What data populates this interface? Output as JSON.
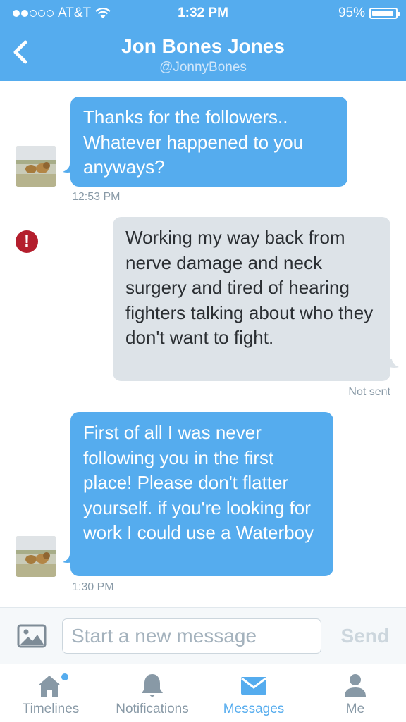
{
  "status_bar": {
    "carrier": "AT&T",
    "time": "1:32 PM",
    "battery": "95%",
    "battery_level": 0.95
  },
  "header": {
    "title": "Jon Bones Jones",
    "handle": "@JonnyBones"
  },
  "messages": [
    {
      "direction": "incoming",
      "text": "Thanks for the followers.. Whatever happened to you anyways?",
      "time": "12:53 PM"
    },
    {
      "direction": "outgoing",
      "text": "Working my way back from nerve damage and neck surgery and tired of hearing fighters talking about who they don't want to fight.",
      "status": "Not sent",
      "error_icon": "exclamation-icon"
    },
    {
      "direction": "incoming",
      "text": "First of all I was never following you in the first place! Please don't flatter yourself. if you're looking for work I could use a Waterboy",
      "time": "1:30 PM"
    }
  ],
  "composer": {
    "placeholder": "Start a new message",
    "send_label": "Send"
  },
  "tabs": [
    {
      "label": "Timelines",
      "icon": "home-icon",
      "active": false,
      "badge": true
    },
    {
      "label": "Notifications",
      "icon": "bell-icon",
      "active": false
    },
    {
      "label": "Messages",
      "icon": "envelope-icon",
      "active": true
    },
    {
      "label": "Me",
      "icon": "person-icon",
      "active": false
    }
  ],
  "colors": {
    "brand": "#55acee",
    "incoming_bubble": "#55acee",
    "outgoing_bubble": "#dde3e8",
    "error": "#b41e2d",
    "muted": "#8899a6"
  }
}
